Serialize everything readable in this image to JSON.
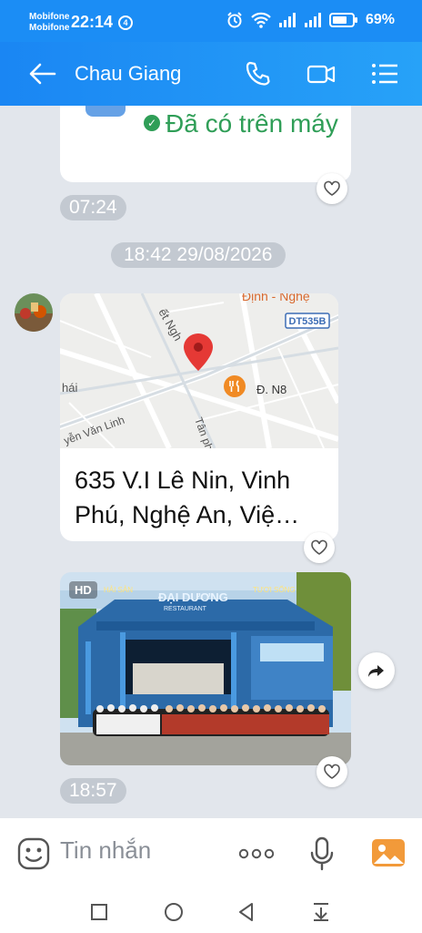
{
  "status_bar": {
    "carrier_1": "Mobifone",
    "carrier_2": "Mobifone",
    "time": "22:14",
    "clock_badge": "4",
    "battery_percent": "69%"
  },
  "header": {
    "title": "Chau Giang",
    "icons": [
      "back-arrow-icon",
      "phone-icon",
      "video-call-icon",
      "menu-list-icon"
    ]
  },
  "messages": {
    "previous_file": {
      "status": "Đã có trên máy",
      "time": "07:24"
    },
    "date_separator": "18:42 29/08/2026",
    "location": {
      "address": "635 V.I Lê Nin, Vinh Phú, Nghệ An, Việ…",
      "map": {
        "labels": [
          "ết Ngh",
          "Định - Nghệ",
          "DT535B",
          "Đ. N8",
          "hái",
          "yễn Văn Linh",
          "Tân ph"
        ]
      }
    },
    "photo": {
      "badge": "HD",
      "sign_text": "ĐẠI DƯƠNG",
      "sign_sub": "RESTAURANT",
      "side_left": "HẢI SẢN",
      "side_right": "TƯƠI SỐNG",
      "time": "18:57"
    }
  },
  "composer": {
    "placeholder": "Tin nhắn"
  },
  "colors": {
    "accent": "#1b8df5",
    "success": "#2f9e57",
    "background": "#e2e6ec",
    "pill": "#c3c9d1"
  }
}
